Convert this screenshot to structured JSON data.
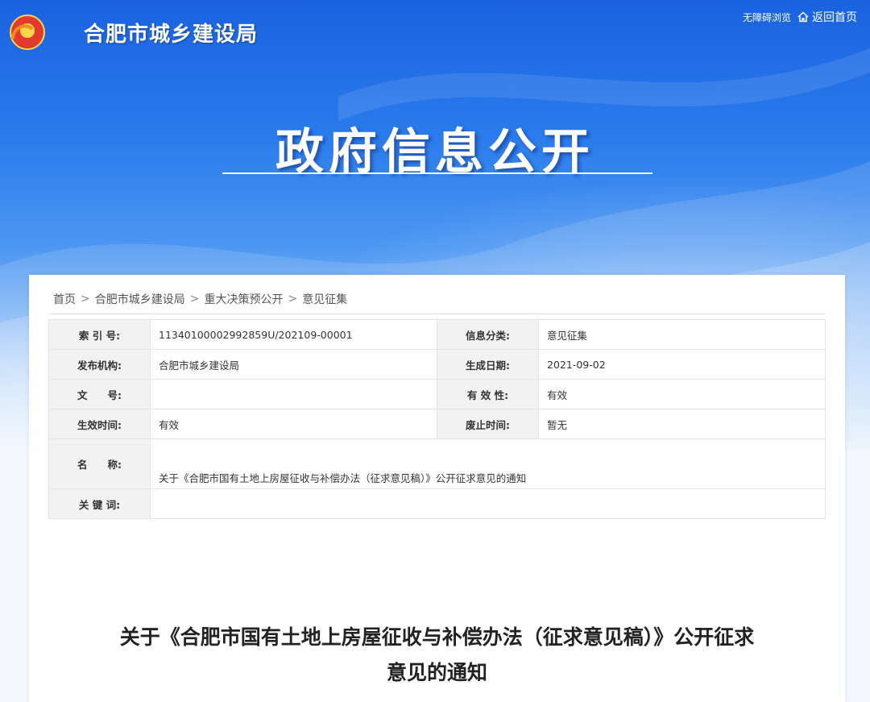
{
  "header": {
    "site_name": "合肥市城乡建设局",
    "accessibility_label": "无障碍浏览",
    "home_label": "返回首页",
    "banner_title": "政府信息公开"
  },
  "breadcrumb": {
    "items": [
      "首页",
      "合肥市城乡建设局",
      "重大决策预公开",
      "意见征集"
    ],
    "separator": ">"
  },
  "meta": {
    "index_label": "索 引 号:",
    "index_value": "11340100002992859U/202109-00001",
    "category_label": "信息分类:",
    "category_value": "意见征集",
    "publisher_label": "发布机构:",
    "publisher_value": "合肥市城乡建设局",
    "date_label": "生成日期:",
    "date_value": "2021-09-02",
    "docno_label": "文　　号:",
    "docno_value": "",
    "validity_label": "有 效 性:",
    "validity_value": "有效",
    "effective_label": "生效时间:",
    "effective_value": "有效",
    "abolish_label": "废止时间:",
    "abolish_value": "暂无",
    "name_label": "名　　称:",
    "name_value": "关于《合肥市国有土地上房屋征收与补偿办法（征求意见稿）》公开征求意见的通知",
    "keywords_label": "关 键 词:",
    "keywords_value": ""
  },
  "document": {
    "title_line1": "关于《合肥市国有土地上房屋征收与补偿办法（征求意见稿）》公开征求",
    "title_line2": "意见的通知"
  },
  "colors": {
    "banner_top": "#1a62e0",
    "banner_bottom": "#eaf3fd",
    "label_bg": "#f2f2f2"
  },
  "icons": [
    "emblem-icon",
    "home-icon"
  ]
}
